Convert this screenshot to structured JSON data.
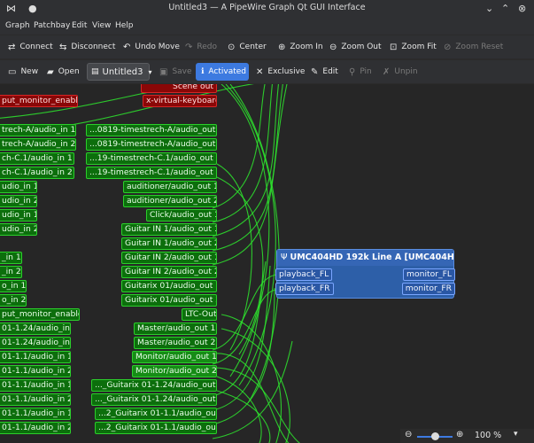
{
  "window": {
    "title": "Untitled3 — A PipeWire Graph Qt GUI Interface",
    "app_icon": "graph-icon"
  },
  "menu": [
    "Graph",
    "Patchbay",
    "Edit",
    "View",
    "Help"
  ],
  "toolbar1": [
    {
      "label": "Connect",
      "icon": "connect-icon",
      "enabled": true
    },
    {
      "label": "Disconnect",
      "icon": "disconnect-icon",
      "enabled": true
    },
    {
      "label": "Undo Move",
      "icon": "undo-icon",
      "enabled": true
    },
    {
      "label": "Redo",
      "icon": "redo-icon",
      "enabled": false
    },
    {
      "label": "Center",
      "icon": "center-icon",
      "enabled": true
    },
    {
      "label": "Zoom In",
      "icon": "zoom-in-icon",
      "enabled": true
    },
    {
      "label": "Zoom Out",
      "icon": "zoom-out-icon",
      "enabled": true
    },
    {
      "label": "Zoom Fit",
      "icon": "zoom-fit-icon",
      "enabled": true
    },
    {
      "label": "Zoom Reset",
      "icon": "zoom-reset-icon",
      "enabled": false
    }
  ],
  "toolbar2": {
    "new": "New",
    "open": "Open",
    "patchbay": "Untitled3",
    "save": "Save",
    "activated": "Activated",
    "exclusive": "Exclusive",
    "edit": "Edit",
    "pin": "Pin",
    "unpin": "Unpin"
  },
  "left_ports": [
    "put_monitor_enable",
    "trech-A/audio_in 1",
    "trech-A/audio_in 2",
    "ch-C.1/audio_in 1",
    "ch-C.1/audio_in 2",
    "udio_in 1",
    "udio_in 2",
    "udio_in 1",
    "udio_in 2",
    "_in 1",
    "_in 2",
    "o_in 1",
    "o_in 2",
    "put_monitor_enable",
    "01-1.24/audio_in 1",
    "01-1.24/audio_in 2",
    "01-1.1/audio_in 1",
    "01-1.1/audio_in 2",
    "01-1.1/audio_in 1",
    "01-1.1/audio_in 2",
    "01-1.1/audio_in 1",
    "01-1.1/audio_in 2"
  ],
  "right_ports": [
    "Scene out",
    "x-virtual-keyboard",
    "...0819-timestrech-A/audio_out 1",
    "...0819-timestrech-A/audio_out 2",
    "...19-timestrech-C.1/audio_out 1",
    "...19-timestrech-C.1/audio_out 2",
    "auditioner/audio_out 1",
    "auditioner/audio_out 2",
    "Click/audio_out 1",
    "Guitar IN 1/audio_out 1",
    "Guitar IN 1/audio_out 2",
    "Guitar IN 2/audio_out 1",
    "Guitar IN 2/audio_out 2",
    "Guitarix 01/audio_out 1",
    "Guitarix 01/audio_out 2",
    "LTC-Out",
    "Master/audio_out 1",
    "Master/audio_out 2",
    "Monitor/audio_out 1",
    "Monitor/audio_out 2",
    "..._Guitarix 01-1.24/audio_out 1",
    "..._Guitarix 01-1.24/audio_out 2",
    "...2_Guitarix 01-1.1/audio_out 1",
    "...2_Guitarix 01-1.1/audio_out 2"
  ],
  "device": {
    "title": "UMC404HD 192k Line A [UMC404H...",
    "icon": "pipewire-icon",
    "inputs": [
      "playback_FL",
      "playback_FR"
    ],
    "outputs": [
      "monitor_FL",
      "monitor_FR"
    ]
  },
  "zoom": "100 %",
  "colors": {
    "port_green": "#0c6e0c",
    "port_red": "#8a0707",
    "device_blue": "#2d5fa8",
    "accent": "#3d7ae0",
    "wire": "#2ee82e"
  }
}
